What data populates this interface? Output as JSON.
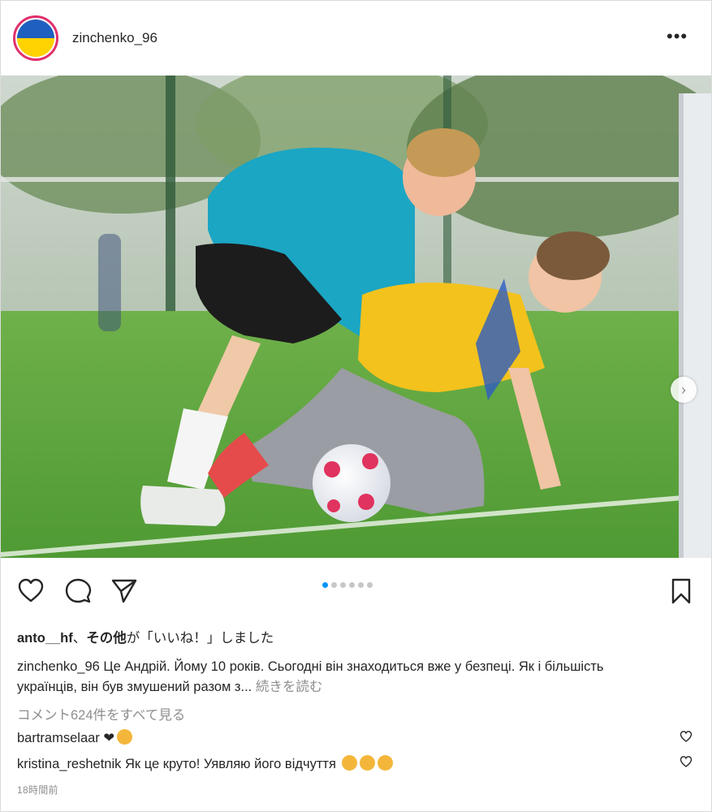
{
  "header": {
    "username": "zinchenko_96",
    "more_label": "•••"
  },
  "carousel": {
    "next_label": "›",
    "slide_count": 6,
    "active_index": 0
  },
  "actions": {
    "like_icon": "heart-icon",
    "comment_icon": "comment-icon",
    "share_icon": "paper-plane-icon",
    "save_icon": "bookmark-icon"
  },
  "likes": {
    "first_user": "anto__hf",
    "separator": "、",
    "others": "その他",
    "suffix": "が「いいね！」しました"
  },
  "caption": {
    "user": "zinchenko_96",
    "text": " Це Андрій. Йому 10 років. Сьогодні він знаходиться вже у безпеці. Як і більшість українців, він був змушений разом з...",
    "more": " 続きを読む"
  },
  "view_comments": "コメント624件をすべて見る",
  "comments": [
    {
      "user": "bartramselaar",
      "text": " ❤"
    },
    {
      "user": "kristina_reshetnik",
      "text": " Як це круто! Уявляю його відчуття "
    }
  ],
  "timestamp": "18時間前",
  "colors": {
    "accent_blue": "#0095f6",
    "flag_blue": "#1f5fbf",
    "flag_yellow": "#ffd200",
    "muted_text": "#8e8e8e"
  }
}
